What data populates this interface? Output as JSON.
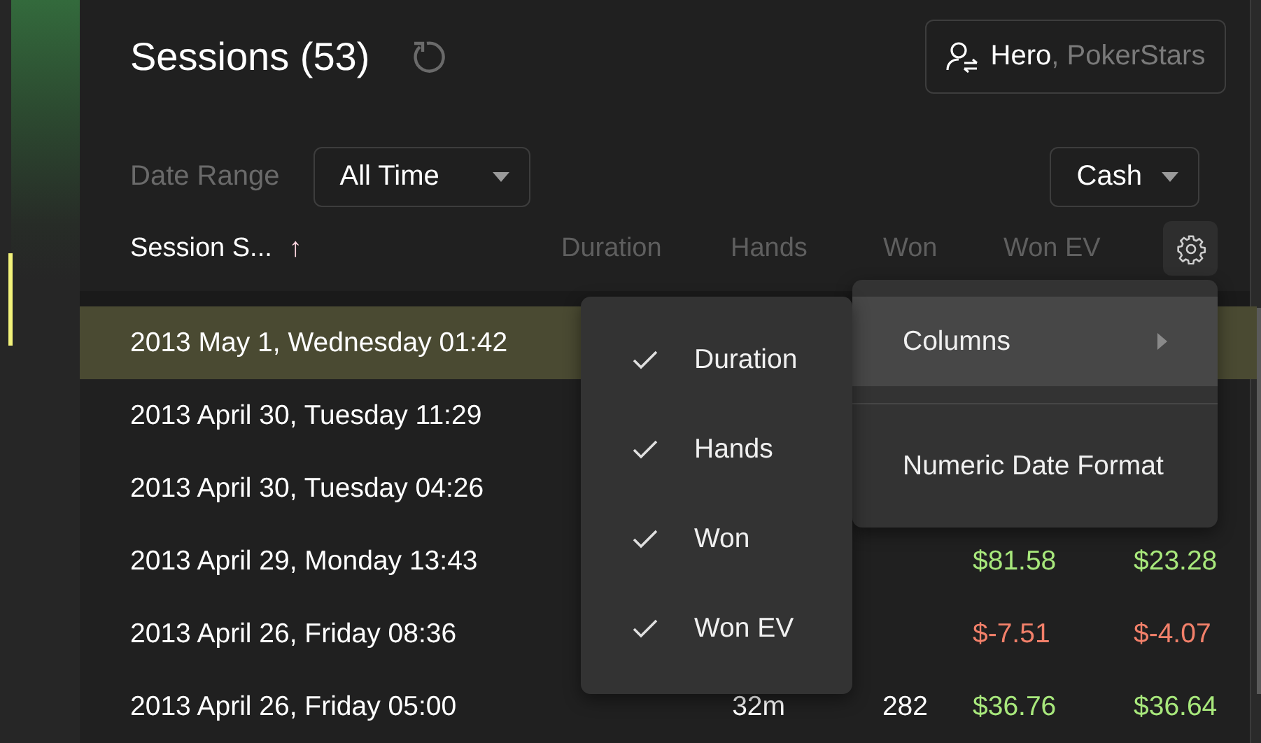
{
  "header": {
    "title": "Sessions (53)",
    "user": {
      "name": "Hero",
      "site": ", PokerStars"
    }
  },
  "filters": {
    "date_range_label": "Date Range",
    "date_range": "All Time",
    "game_type": "Cash"
  },
  "table": {
    "columns": [
      {
        "label": "Session S...",
        "sort": "↑",
        "kind": "date"
      },
      {
        "label": "Duration",
        "kind": "duration"
      },
      {
        "label": "Hands",
        "kind": "hands"
      },
      {
        "label": "Won",
        "kind": "won"
      },
      {
        "label": "Won EV",
        "kind": "won_ev"
      }
    ],
    "rows": [
      {
        "selected": true,
        "date": "2013 May 1, Wednesday 01:42"
      },
      {
        "selected": false,
        "date": "2013 April 30, Tuesday 11:29"
      },
      {
        "selected": false,
        "date": "2013 April 30, Tuesday 04:26"
      },
      {
        "selected": false,
        "date": "2013 April 29, Monday 13:43",
        "won": {
          "text": "$81.58",
          "kind": "positive"
        },
        "won_ev": {
          "text": "$23.28",
          "kind": "positive"
        }
      },
      {
        "selected": false,
        "date": "2013 April 26, Friday 08:36",
        "won": {
          "text": "$-7.51",
          "kind": "negative"
        },
        "won_ev": {
          "text": "$-4.07",
          "kind": "negative"
        }
      },
      {
        "selected": false,
        "date": "2013 April 26, Friday 05:00",
        "duration": "32m",
        "hands": "282",
        "won": {
          "text": "$36.76",
          "kind": "positive"
        },
        "won_ev": {
          "text": "$36.64",
          "kind": "positive"
        }
      }
    ]
  },
  "settings_menu": {
    "items": [
      {
        "label": "Columns",
        "kind": "submenu",
        "highlighted": true
      },
      {
        "label": "Numeric Date Format",
        "kind": "action",
        "highlighted": false
      }
    ]
  },
  "columns_submenu": {
    "items": [
      {
        "label": "Duration",
        "checked": true
      },
      {
        "label": "Hands",
        "checked": true
      },
      {
        "label": "Won",
        "checked": true
      },
      {
        "label": "Won EV",
        "checked": true
      }
    ]
  }
}
